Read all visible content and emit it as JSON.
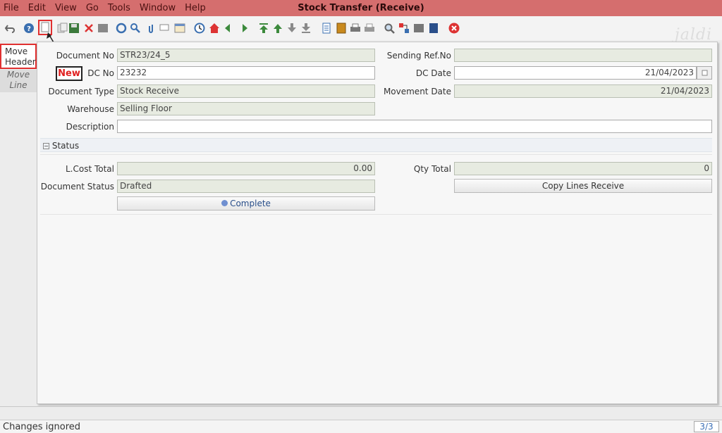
{
  "window": {
    "title": "Stock Transfer (Receive)",
    "watermark": "jaldi"
  },
  "menu": [
    "File",
    "Edit",
    "View",
    "Go",
    "Tools",
    "Window",
    "Help"
  ],
  "toolbar": {
    "icons": [
      "undo-icon",
      "help-icon",
      "new-record-icon",
      "copy-record-icon",
      "save-icon",
      "delete-icon",
      "delete-selection-icon",
      "refresh-icon",
      "find-icon",
      "attachment-icon",
      "chat-icon",
      "grid-toggle-icon",
      "history-icon",
      "home-icon",
      "back-icon",
      "forward-icon",
      "first-record-icon",
      "previous-record-icon",
      "next-record-icon",
      "last-record-icon",
      "report-icon",
      "archive-icon",
      "print-preview-icon",
      "print-icon",
      "zoom-across-icon",
      "workflow-icon",
      "product-info-icon",
      "request-icon",
      "close-window-icon"
    ],
    "callout": "New"
  },
  "tabs": {
    "header": "Move Header",
    "line": "Move Line"
  },
  "form": {
    "document_no": {
      "label": "Document No",
      "value": "STR23/24_5"
    },
    "sending_ref": {
      "label": "Sending Ref.No",
      "value": ""
    },
    "dc_no": {
      "label": "DC No",
      "value": "23232"
    },
    "dc_date": {
      "label": "DC Date",
      "value": "21/04/2023"
    },
    "document_type": {
      "label": "Document Type",
      "value": "Stock Receive"
    },
    "movement_date": {
      "label": "Movement Date",
      "value": "21/04/2023"
    },
    "warehouse": {
      "label": "Warehouse",
      "value": "Selling Floor"
    },
    "description": {
      "label": "Description",
      "value": ""
    }
  },
  "status_section": {
    "title": "Status",
    "lcost_total": {
      "label": "L.Cost Total",
      "value": "0.00"
    },
    "qty_total": {
      "label": "Qty Total",
      "value": "0"
    },
    "document_status": {
      "label": "Document Status",
      "value": "Drafted"
    },
    "complete_button": "Complete",
    "copy_lines_button": "Copy Lines Receive"
  },
  "statusbar": {
    "message": "Changes ignored",
    "pager": "3/3"
  },
  "colors": {
    "titlebar": "#d56e6e",
    "readonly_field": "#e7ebe1",
    "highlight": "#e03030"
  }
}
